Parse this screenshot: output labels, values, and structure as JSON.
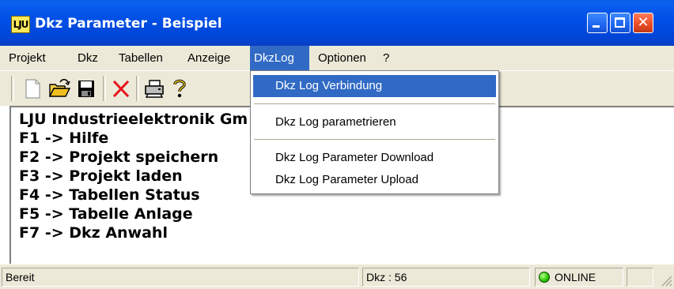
{
  "window": {
    "title": "Dkz Parameter - Beispiel",
    "icon_text": "LJU"
  },
  "menu": [
    {
      "label": "Projekt"
    },
    {
      "label": "Dkz"
    },
    {
      "label": "Tabellen"
    },
    {
      "label": "Anzeige"
    },
    {
      "label": "DkzLog"
    },
    {
      "label": "Optionen"
    },
    {
      "label": "?"
    }
  ],
  "dropdown": {
    "items": [
      {
        "label": "Dkz Log Verbindung"
      },
      {
        "label": "Dkz Log parametrieren"
      },
      {
        "label": "Dkz Log Parameter  Download"
      },
      {
        "label": "Dkz Log Parameter Upload"
      }
    ]
  },
  "toolbar": {
    "icons": [
      "new-file-icon",
      "open-folder-icon",
      "save-disk-icon",
      "delete-x-icon",
      "print-icon",
      "help-icon"
    ]
  },
  "content": {
    "lines": [
      "LJU Industrieelektronik Gm",
      "F1 -> Hilfe",
      "F2 -> Projekt speichern",
      "F3 -> Projekt laden",
      "F4 -> Tabellen Status",
      "F5 -> Tabelle Anlage",
      "F7 -> Dkz Anwahl"
    ]
  },
  "status": {
    "ready": "Bereit",
    "dkz": "Dkz : 56",
    "online": "ONLINE"
  },
  "colors": {
    "highlight": "#316ac5",
    "chrome": "#ece9d8",
    "titlebar": "#0050e6"
  }
}
